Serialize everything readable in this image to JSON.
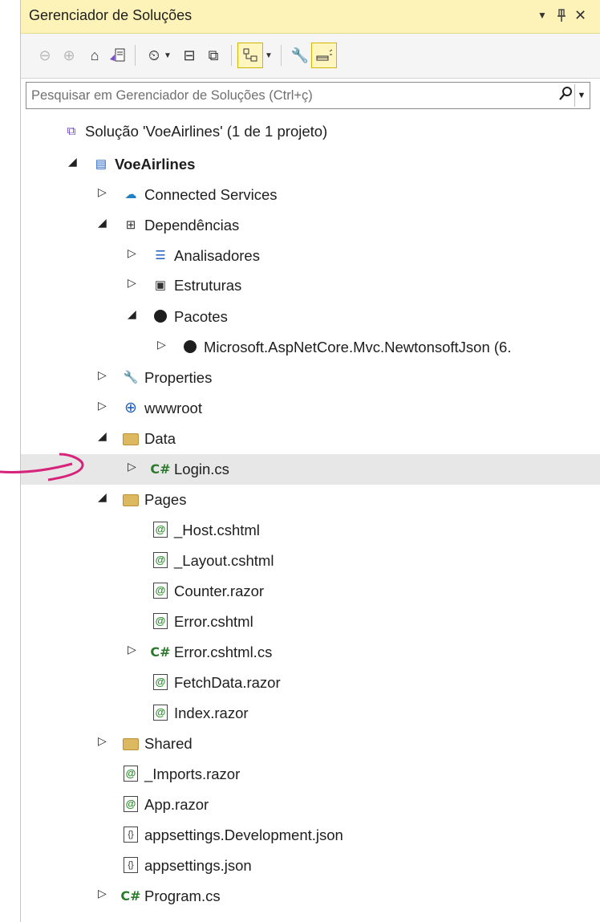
{
  "panel": {
    "title": "Gerenciador de Soluções",
    "title_buttons": {
      "dropdown": "▼",
      "pin": "📌",
      "close": "✕"
    }
  },
  "search": {
    "placeholder": "Pesquisar em Gerenciador de Soluções (Ctrl+ç)"
  },
  "tree": [
    {
      "label": "Solução 'VoeAirlines' (1 de 1 projeto)",
      "icon": "solution-icon"
    },
    {
      "label": "VoeAirlines",
      "icon": "project-icon",
      "bold": true,
      "expanded": true
    },
    {
      "label": "Connected Services",
      "icon": "connected-services-icon",
      "expanded": false
    },
    {
      "label": "Dependências",
      "icon": "dependencies-icon",
      "expanded": true
    },
    {
      "label": "Analisadores",
      "icon": "analyzer-icon",
      "expanded": false
    },
    {
      "label": "Estruturas",
      "icon": "framework-icon",
      "expanded": false
    },
    {
      "label": "Pacotes",
      "icon": "package-icon",
      "expanded": true
    },
    {
      "label": "Microsoft.AspNetCore.Mvc.NewtonsoftJson (6.",
      "icon": "package-icon",
      "expanded": false
    },
    {
      "label": "Properties",
      "icon": "properties-icon",
      "expanded": false
    },
    {
      "label": "wwwroot",
      "icon": "globe-icon",
      "expanded": false
    },
    {
      "label": "Data",
      "icon": "folder-icon",
      "expanded": true
    },
    {
      "label": "Login.cs",
      "icon": "csharp-icon",
      "expanded": false,
      "selected": true
    },
    {
      "label": "Pages",
      "icon": "folder-icon",
      "expanded": true
    },
    {
      "label": "_Host.cshtml",
      "icon": "razor-icon"
    },
    {
      "label": "_Layout.cshtml",
      "icon": "razor-icon"
    },
    {
      "label": "Counter.razor",
      "icon": "razor-icon"
    },
    {
      "label": "Error.cshtml",
      "icon": "razor-icon"
    },
    {
      "label": "Error.cshtml.cs",
      "icon": "csharp-icon",
      "expanded": false
    },
    {
      "label": "FetchData.razor",
      "icon": "razor-icon"
    },
    {
      "label": "Index.razor",
      "icon": "razor-icon"
    },
    {
      "label": "Shared",
      "icon": "folder-icon",
      "expanded": false
    },
    {
      "label": "_Imports.razor",
      "icon": "razor-icon"
    },
    {
      "label": "App.razor",
      "icon": "razor-icon"
    },
    {
      "label": "appsettings.Development.json",
      "icon": "json-icon"
    },
    {
      "label": "appsettings.json",
      "icon": "json-icon"
    },
    {
      "label": "Program.cs",
      "icon": "csharp-icon",
      "expanded": false
    }
  ],
  "icon_text": {
    "csharp": "C#",
    "razor": "@",
    "json": "{}"
  },
  "colors": {
    "title_bg": "#fdf3b9",
    "selected_row": "#e7e7e7",
    "annotation_arrow": "#d6247a"
  }
}
